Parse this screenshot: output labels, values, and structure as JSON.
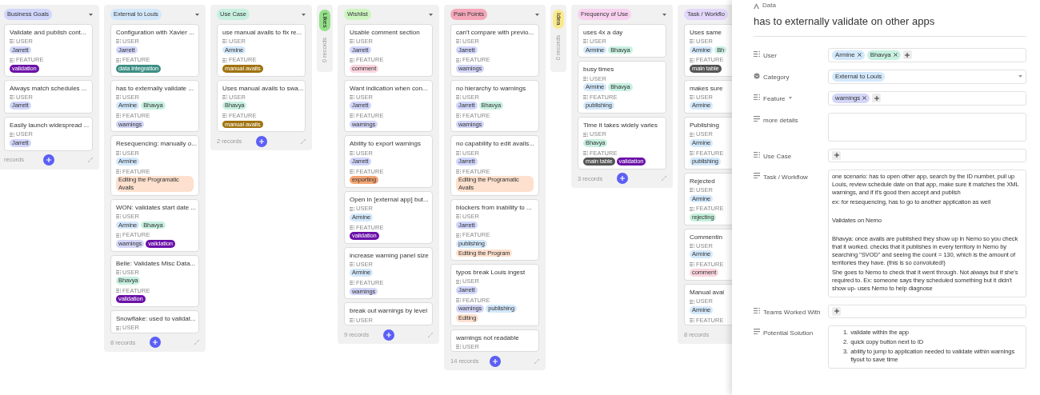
{
  "board": {
    "columns": [
      {
        "title": "Business Goals",
        "color": "#d1d6fb",
        "collapsed": false,
        "partial": false,
        "count": "records",
        "cards": [
          {
            "title": "Validate and publish cont...",
            "fields": [
              {
                "label": "USER",
                "chips": [
                  {
                    "label": "Jarrett",
                    "color": "#d1d6fb"
                  }
                ]
              },
              {
                "label": "FEATURE",
                "chips": [
                  {
                    "label": "validation",
                    "color": "#6b11a8"
                  }
                ]
              }
            ]
          },
          {
            "title": "Always match schedules ...",
            "fields": [
              {
                "label": "USER",
                "chips": [
                  {
                    "label": "Jarrett",
                    "color": "#d1d6fb"
                  }
                ]
              }
            ]
          },
          {
            "title": "Easily launch widespread ...",
            "fields": [
              {
                "label": "USER",
                "chips": [
                  {
                    "label": "Jarrett",
                    "color": "#d1d6fb"
                  }
                ]
              }
            ]
          }
        ]
      },
      {
        "title": "External to Louis",
        "color": "#d3e8fb",
        "collapsed": false,
        "partial": false,
        "count": "8 records",
        "cards": [
          {
            "title": "Configuration with Xavier ...",
            "fields": [
              {
                "label": "USER",
                "chips": [
                  {
                    "label": "Jarrett",
                    "color": "#d1d6fb"
                  }
                ]
              },
              {
                "label": "FEATURE",
                "chips": [
                  {
                    "label": "data integration",
                    "color": "#3c8f85"
                  }
                ]
              }
            ]
          },
          {
            "title": "has to externally validate ...",
            "fields": [
              {
                "label": "USER",
                "chips": [
                  {
                    "label": "Armine",
                    "color": "#d3e8fb"
                  },
                  {
                    "label": "Bhavya",
                    "color": "#c7f0e0"
                  }
                ]
              },
              {
                "label": "FEATURE",
                "chips": [
                  {
                    "label": "warnings",
                    "color": "#d3d6f7"
                  }
                ]
              }
            ]
          },
          {
            "title": "Resequencing: manually o...",
            "fields": [
              {
                "label": "USER",
                "chips": [
                  {
                    "label": "Armine",
                    "color": "#d3e8fb"
                  }
                ]
              },
              {
                "label": "FEATURE",
                "chips": [
                  {
                    "label": "Editing the Programatic Avails",
                    "color": "#fde0cd"
                  }
                ]
              }
            ]
          },
          {
            "title": "WON: validates start date ...",
            "fields": [
              {
                "label": "USER",
                "chips": [
                  {
                    "label": "Armine",
                    "color": "#d3e8fb"
                  },
                  {
                    "label": "Bhavya",
                    "color": "#c7f0e0"
                  }
                ]
              },
              {
                "label": "FEATURE",
                "chips": [
                  {
                    "label": "warnings",
                    "color": "#d3d6f7"
                  },
                  {
                    "label": "validation",
                    "color": "#6b11a8"
                  }
                ]
              }
            ]
          },
          {
            "title": "Belle: Validates Misc Data...",
            "fields": [
              {
                "label": "USER",
                "chips": [
                  {
                    "label": "Bhavya",
                    "color": "#c7f0e0"
                  }
                ]
              },
              {
                "label": "FEATURE",
                "chips": [
                  {
                    "label": "validation",
                    "color": "#6b11a8"
                  }
                ]
              }
            ]
          },
          {
            "title": "Snowflake: used to validat...",
            "fields": [
              {
                "label": "USER"
              }
            ]
          }
        ]
      },
      {
        "title": "Use Case",
        "color": "#c7f0e0",
        "collapsed": false,
        "partial": false,
        "count": "2 records",
        "cards": [
          {
            "title": "use manual avails to fix re...",
            "fields": [
              {
                "label": "USER",
                "chips": [
                  {
                    "label": "Armine",
                    "color": "#d3e8fb"
                  }
                ]
              },
              {
                "label": "FEATURE",
                "chips": [
                  {
                    "label": "manual avails",
                    "color": "#a0720f"
                  }
                ]
              }
            ]
          },
          {
            "title": "Uses manual avails to swa...",
            "fields": [
              {
                "label": "USER",
                "chips": [
                  {
                    "label": "Bhavya",
                    "color": "#c7f0e0"
                  }
                ]
              },
              {
                "label": "FEATURE",
                "chips": [
                  {
                    "label": "manual avails",
                    "color": "#a0720f"
                  }
                ]
              }
            ]
          }
        ]
      },
      {
        "title": "Likes",
        "color": "#94e08a",
        "collapsed": true,
        "partial": false,
        "count": "0 records"
      },
      {
        "title": "Wishlist",
        "color": "#cdf5c0",
        "collapsed": false,
        "partial": false,
        "count": "9 records",
        "cards": [
          {
            "title": "Usable comment section",
            "fields": [
              {
                "label": "USER",
                "chips": [
                  {
                    "label": "Jarrett",
                    "color": "#d1d6fb"
                  }
                ]
              },
              {
                "label": "FEATURE",
                "chips": [
                  {
                    "label": "comment",
                    "color": "#fbd5df"
                  }
                ]
              }
            ]
          },
          {
            "title": "Want indication when con...",
            "fields": [
              {
                "label": "USER",
                "chips": [
                  {
                    "label": "Jarrett",
                    "color": "#d1d6fb"
                  }
                ]
              },
              {
                "label": "FEATURE",
                "chips": [
                  {
                    "label": "warnings",
                    "color": "#d3d6f7"
                  }
                ]
              }
            ]
          },
          {
            "title": "Ability to export warnings",
            "fields": [
              {
                "label": "USER",
                "chips": [
                  {
                    "label": "Jarrett",
                    "color": "#d1d6fb"
                  }
                ]
              },
              {
                "label": "FEATURE",
                "chips": [
                  {
                    "label": "exporting",
                    "color": "#f4a574"
                  }
                ]
              }
            ]
          },
          {
            "title": "Open in [external app] but...",
            "fields": [
              {
                "label": "USER",
                "chips": [
                  {
                    "label": "Armine",
                    "color": "#d3e8fb"
                  }
                ]
              },
              {
                "label": "FEATURE",
                "chips": [
                  {
                    "label": "validation",
                    "color": "#6b11a8"
                  }
                ]
              }
            ]
          },
          {
            "title": "increase warning panel size",
            "fields": [
              {
                "label": "USER",
                "chips": [
                  {
                    "label": "Armine",
                    "color": "#d3e8fb"
                  }
                ]
              },
              {
                "label": "FEATURE",
                "chips": [
                  {
                    "label": "warnings",
                    "color": "#d3d6f7"
                  }
                ]
              }
            ]
          },
          {
            "title": "break out warnings by level",
            "fields": [
              {
                "label": "USER"
              }
            ]
          }
        ]
      },
      {
        "title": "Pain Points",
        "color": "#f5a7ba",
        "collapsed": false,
        "partial": false,
        "count": "14 records",
        "cards": [
          {
            "title": "can't compare with previo...",
            "fields": [
              {
                "label": "USER",
                "chips": [
                  {
                    "label": "Jarrett",
                    "color": "#d1d6fb"
                  }
                ]
              },
              {
                "label": "FEATURE",
                "chips": [
                  {
                    "label": "warnings",
                    "color": "#d3d6f7"
                  }
                ]
              }
            ]
          },
          {
            "title": "no hierarchy to warnings",
            "fields": [
              {
                "label": "USER",
                "chips": [
                  {
                    "label": "Jarrett",
                    "color": "#d1d6fb"
                  },
                  {
                    "label": "Bhavya",
                    "color": "#c7f0e0"
                  }
                ]
              },
              {
                "label": "FEATURE",
                "chips": [
                  {
                    "label": "warnings",
                    "color": "#d3d6f7"
                  }
                ]
              }
            ]
          },
          {
            "title": "no capability to edit avails...",
            "fields": [
              {
                "label": "USER",
                "chips": [
                  {
                    "label": "Jarrett",
                    "color": "#d1d6fb"
                  }
                ]
              },
              {
                "label": "FEATURE",
                "chips": [
                  {
                    "label": "Editing the Programatic Avails",
                    "color": "#fde0cd"
                  }
                ]
              }
            ]
          },
          {
            "title": "blockers from inability to ...",
            "fields": [
              {
                "label": "USER",
                "chips": [
                  {
                    "label": "Jarrett",
                    "color": "#d1d6fb"
                  }
                ]
              },
              {
                "label": "FEATURE",
                "chips": [
                  {
                    "label": "publishing",
                    "color": "#d3e8fb"
                  },
                  {
                    "label": "Editing the Program",
                    "color": "#fde0cd"
                  }
                ]
              }
            ]
          },
          {
            "title": "typos break Louis ingest",
            "fields": [
              {
                "label": "USER",
                "chips": [
                  {
                    "label": "Jarrett",
                    "color": "#d1d6fb"
                  }
                ]
              },
              {
                "label": "FEATURE",
                "chips": [
                  {
                    "label": "warnings",
                    "color": "#d3d6f7"
                  },
                  {
                    "label": "publishing",
                    "color": "#d3e8fb"
                  },
                  {
                    "label": "Editing",
                    "color": "#fde0cd"
                  }
                ]
              }
            ]
          },
          {
            "title": "warnings not readable",
            "fields": [
              {
                "label": "USER"
              }
            ]
          }
        ]
      },
      {
        "title": "Idea",
        "color": "#fbe98a",
        "collapsed": true,
        "partial": false,
        "count": "0 records"
      },
      {
        "title": "Frequency of Use",
        "color": "#f9d2f0",
        "collapsed": false,
        "partial": false,
        "count": "3 records",
        "cards": [
          {
            "title": "uses 4x a day",
            "fields": [
              {
                "label": "USER",
                "chips": [
                  {
                    "label": "Armine",
                    "color": "#d3e8fb"
                  },
                  {
                    "label": "Bhavya",
                    "color": "#c7f0e0"
                  }
                ]
              }
            ]
          },
          {
            "title": "busy times",
            "fields": [
              {
                "label": "USER",
                "chips": [
                  {
                    "label": "Armine",
                    "color": "#d3e8fb"
                  },
                  {
                    "label": "Bhavya",
                    "color": "#c7f0e0"
                  }
                ]
              },
              {
                "label": "FEATURE",
                "chips": [
                  {
                    "label": "publishing",
                    "color": "#d3e8fb"
                  }
                ]
              }
            ]
          },
          {
            "title": "Time it takes widely varies",
            "fields": [
              {
                "label": "USER",
                "chips": [
                  {
                    "label": "Bhavya",
                    "color": "#c7f0e0"
                  }
                ]
              },
              {
                "label": "FEATURE",
                "chips": [
                  {
                    "label": "main table",
                    "color": "#555555"
                  },
                  {
                    "label": "validation",
                    "color": "#6b11a8"
                  }
                ]
              }
            ]
          }
        ]
      },
      {
        "title": "Task / Workflo",
        "color": "#e3d7fb",
        "collapsed": false,
        "partial": true,
        "count": "8 records",
        "cards": [
          {
            "title": "Uses same",
            "fields": [
              {
                "label": "USER",
                "chips": [
                  {
                    "label": "Armine",
                    "color": "#d3e8fb"
                  },
                  {
                    "label": "Bh",
                    "color": "#c7f0e0"
                  }
                ]
              },
              {
                "label": "FEATURE",
                "chips": [
                  {
                    "label": "main table",
                    "color": "#555555"
                  }
                ]
              }
            ]
          },
          {
            "title": "makes sure",
            "fields": [
              {
                "label": "USER",
                "chips": [
                  {
                    "label": "Armine",
                    "color": "#d3e8fb"
                  }
                ]
              }
            ]
          },
          {
            "title": "Publishing",
            "fields": [
              {
                "label": "USER",
                "chips": [
                  {
                    "label": "Armine",
                    "color": "#d3e8fb"
                  }
                ]
              },
              {
                "label": "FEATURE",
                "chips": [
                  {
                    "label": "publishing",
                    "color": "#d3e8fb"
                  }
                ]
              }
            ]
          },
          {
            "title": "Rejected",
            "fields": [
              {
                "label": "USER",
                "chips": [
                  {
                    "label": "Armine",
                    "color": "#d3e8fb"
                  }
                ]
              },
              {
                "label": "FEATURE",
                "chips": [
                  {
                    "label": "rejecting",
                    "color": "#c5f0dc"
                  }
                ]
              }
            ]
          },
          {
            "title": "Commentin",
            "fields": [
              {
                "label": "USER",
                "chips": [
                  {
                    "label": "Armine",
                    "color": "#d3e8fb"
                  }
                ]
              },
              {
                "label": "FEATURE",
                "chips": [
                  {
                    "label": "comment",
                    "color": "#fbd5df"
                  }
                ]
              }
            ]
          },
          {
            "title": "Manual avai",
            "fields": [
              {
                "label": "USER",
                "chips": [
                  {
                    "label": "Armine",
                    "color": "#d3e8fb"
                  }
                ]
              },
              {
                "label": "FEATURE"
              }
            ]
          }
        ]
      }
    ]
  },
  "detail": {
    "breadcrumb": "Data",
    "title": "has to externally validate on other apps",
    "fields": [
      {
        "kind": "link",
        "label": "User",
        "label_caret": false,
        "chips": [
          {
            "label": "Armine",
            "color": "#d3e8fb"
          },
          {
            "label": "Bhavya",
            "color": "#c7f0e0"
          }
        ]
      },
      {
        "kind": "select",
        "label": "Category",
        "label_caret": false,
        "chips": [
          {
            "label": "External to Louis",
            "color": "#d3e8fb"
          }
        ]
      },
      {
        "kind": "link",
        "label": "Feature",
        "label_caret": true,
        "chips": [
          {
            "label": "warnings",
            "color": "#d3d6f7"
          }
        ]
      },
      {
        "kind": "longtext",
        "label": "more details",
        "label_caret": false
      },
      {
        "kind": "link",
        "label": "Use Case",
        "label_caret": false
      },
      {
        "kind": "longtext",
        "label": "Task / Workflow",
        "label_caret": false,
        "paragraphs": [
          {
            "text": "one scenario: has to open other app, search by the ID number, pull up Louis, review schedule date on that app, make sure it matches the XML warnings, and if it's good then accept and publish",
            "spaced": false
          },
          {
            "text": "ex: for resequencing, has to go to another application as well",
            "spaced": false
          },
          {
            "text": "Validates on Nemo",
            "spaced": true
          },
          {
            "text": "Bhavya: once avails are published they show up in Nemo so you check that it worked. checks that it publishes in every territory in Nemo by searching \"SVOD\" and seeing the count = 130, which is the amount of territories they have. (this is so convoluted!)",
            "spaced": true
          },
          {
            "text": "She goes to Nemo to check that it went through. Not always but if she's required to. Ex: someone says they scheduled something but it didn't show up- uses Nemo to help diagnose",
            "spaced": false
          }
        ]
      },
      {
        "kind": "link",
        "label": "Teams Worked With",
        "label_caret": false
      },
      {
        "kind": "longtext",
        "label": "Potential Solution",
        "label_caret": false,
        "ordered_items": [
          {
            "marker": "1.",
            "text": "validate within the app"
          },
          {
            "marker": "2.",
            "text": "quick copy button next to ID"
          },
          {
            "marker": "3.",
            "text": "ability to jump to application needed to validate within warnings flyout to save time"
          }
        ]
      }
    ]
  }
}
